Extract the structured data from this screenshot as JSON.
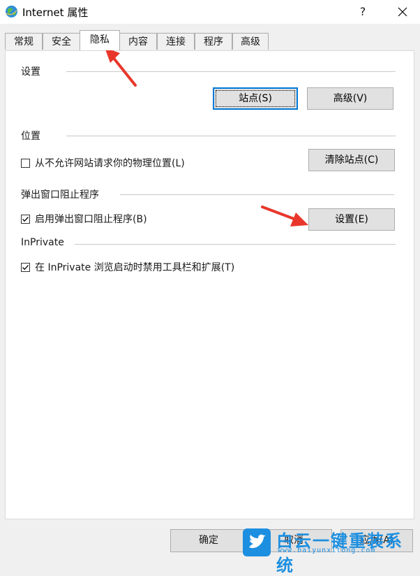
{
  "window": {
    "title": "Internet 属性",
    "help": "?"
  },
  "tabs": [
    {
      "label": "常规"
    },
    {
      "label": "安全"
    },
    {
      "label": "隐私",
      "active": true
    },
    {
      "label": "内容"
    },
    {
      "label": "连接"
    },
    {
      "label": "程序"
    },
    {
      "label": "高级"
    }
  ],
  "settings": {
    "heading": "设置",
    "sites_button": "站点(S)",
    "advanced_button": "高级(V)"
  },
  "location": {
    "heading": "位置",
    "checkbox_label": "从不允许网站请求你的物理位置(L)",
    "checked": false,
    "clear_sites_button": "清除站点(C)"
  },
  "popup_blocker": {
    "heading": "弹出窗口阻止程序",
    "checkbox_label": "启用弹出窗口阻止程序(B)",
    "checked": true,
    "settings_button": "设置(E)"
  },
  "inprivate": {
    "heading": "InPrivate",
    "checkbox_label": "在 InPrivate 浏览启动时禁用工具栏和扩展(T)",
    "checked": true
  },
  "footer": {
    "ok_button": "确定",
    "cancel_button": "取消",
    "apply_button": "应用(A)"
  },
  "watermark": {
    "text": "白云一键重装系统",
    "url": "www.baiyunxitong.com"
  },
  "colors": {
    "accent_focus": "#0078d7",
    "annotation_arrow": "#e8372a",
    "watermark_blue": "#1d8fe0"
  }
}
